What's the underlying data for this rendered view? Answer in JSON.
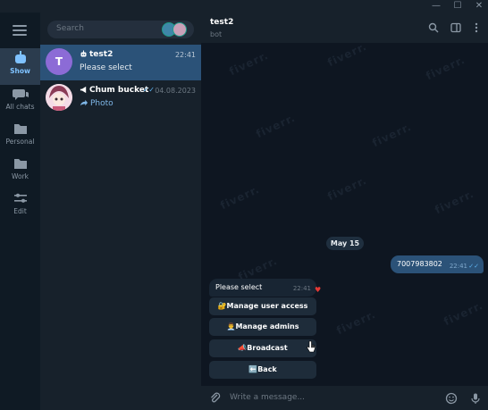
{
  "window": {
    "minimize": "—",
    "maximize": "☐",
    "close": "✕"
  },
  "rail": {
    "items": [
      {
        "label": "Show",
        "icon": "bot-icon",
        "active": true
      },
      {
        "label": "All chats",
        "icon": "chats-icon",
        "active": false
      },
      {
        "label": "Personal",
        "icon": "folder-icon",
        "active": false
      },
      {
        "label": "Work",
        "icon": "folder-icon",
        "active": false
      },
      {
        "label": "Edit",
        "icon": "sliders-icon",
        "active": false
      }
    ]
  },
  "search": {
    "placeholder": "Search"
  },
  "chats": [
    {
      "name": "test2",
      "time": "22:41",
      "preview": "Please select",
      "avatar_letter": "T",
      "selected": true
    },
    {
      "name": "Chum bucket",
      "time": "04.08.2023",
      "preview": "Photo",
      "selected": false
    }
  ],
  "header": {
    "title": "test2",
    "subtitle": "bot"
  },
  "messages": {
    "date": "May 15",
    "outgoing": {
      "text": "7007983802",
      "time": "22:41"
    },
    "incoming": {
      "text": "Please select",
      "time": "22:41"
    }
  },
  "keyboard": [
    {
      "label": "🔐Manage user access"
    },
    {
      "label": "👨‍💼Manage admins"
    },
    {
      "label": "📣Broadcast"
    },
    {
      "label": "⬅️Back"
    }
  ],
  "composer": {
    "placeholder": "Write a message..."
  },
  "watermark": "fiverr.",
  "colors": {
    "accent": "#2b5278",
    "link": "#7fb7e8",
    "avatar": "#8c6bd6",
    "heart": "#e53935"
  }
}
